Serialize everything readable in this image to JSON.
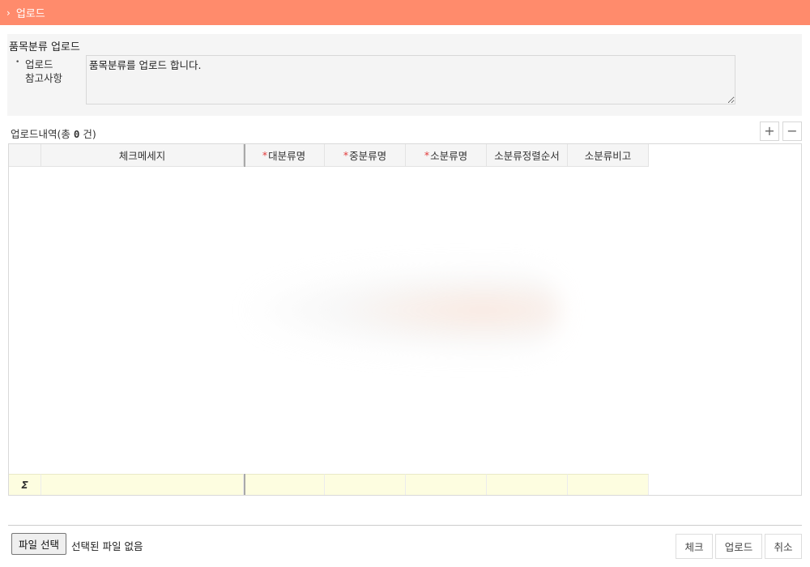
{
  "window": {
    "title": "업로드"
  },
  "notice": {
    "heading": "품목분류 업로드",
    "label_line1": "업로드",
    "label_line2": "참고사항",
    "text": "품목분류를 업로드 합니다."
  },
  "history": {
    "prefix": "업로드내역(총 ",
    "count": "0",
    "suffix": " 건)"
  },
  "grid": {
    "columns": [
      {
        "label": "",
        "required": false
      },
      {
        "label": "체크메세지",
        "required": false
      },
      {
        "label": "대분류명",
        "required": true
      },
      {
        "label": "중분류명",
        "required": true
      },
      {
        "label": "소분류명",
        "required": true
      },
      {
        "label": "소분류정렬순서",
        "required": false
      },
      {
        "label": "소분류비고",
        "required": false
      }
    ],
    "rows": [],
    "footer_symbol": "Σ"
  },
  "file": {
    "button_label": "파일 선택",
    "status": "선택된 파일 없음"
  },
  "actions": {
    "check": "체크",
    "upload": "업로드",
    "cancel": "취소"
  },
  "toolbar": {
    "add_icon": "plus-icon",
    "remove_icon": "minus-icon"
  },
  "colors": {
    "title_bar": "#ff8b6c",
    "required_mark": "#e23c3c",
    "footer_row": "#fdfde0"
  }
}
